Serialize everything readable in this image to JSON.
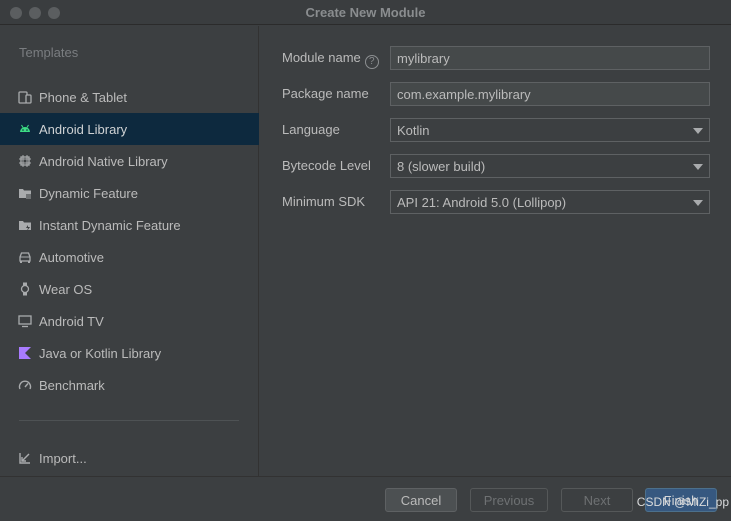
{
  "window": {
    "title": "Create New Module"
  },
  "sidebar": {
    "header": "Templates",
    "items": [
      {
        "label": "Phone & Tablet",
        "icon": "phone-tablet-icon",
        "selected": false
      },
      {
        "label": "Android Library",
        "icon": "android-icon",
        "selected": true
      },
      {
        "label": "Android Native Library",
        "icon": "native-library-icon",
        "selected": false
      },
      {
        "label": "Dynamic Feature",
        "icon": "folder-icon",
        "selected": false
      },
      {
        "label": "Instant Dynamic Feature",
        "icon": "folder-lightning-icon",
        "selected": false
      },
      {
        "label": "Automotive",
        "icon": "car-icon",
        "selected": false
      },
      {
        "label": "Wear OS",
        "icon": "watch-icon",
        "selected": false
      },
      {
        "label": "Android TV",
        "icon": "tv-icon",
        "selected": false
      },
      {
        "label": "Java or Kotlin Library",
        "icon": "kotlin-icon",
        "selected": false
      },
      {
        "label": "Benchmark",
        "icon": "gauge-icon",
        "selected": false
      }
    ],
    "import_label": "Import..."
  },
  "form": {
    "module_name": {
      "label": "Module name",
      "value": "mylibrary"
    },
    "package_name": {
      "label": "Package name",
      "value": "com.example.mylibrary"
    },
    "language": {
      "label": "Language",
      "value": "Kotlin"
    },
    "bytecode_level": {
      "label": "Bytecode Level",
      "value": "8 (slower build)"
    },
    "minimum_sdk": {
      "label": "Minimum SDK",
      "value": "API 21: Android 5.0 (Lollipop)"
    }
  },
  "footer": {
    "cancel": "Cancel",
    "previous": "Previous",
    "next": "Next",
    "finish": "Finish",
    "watermark": "CSDN @MiZi_pp"
  },
  "colors": {
    "accent": "#365880",
    "selected_row": "#0d293e",
    "kotlin": "#a97bff",
    "android_green": "#3ddc84"
  }
}
